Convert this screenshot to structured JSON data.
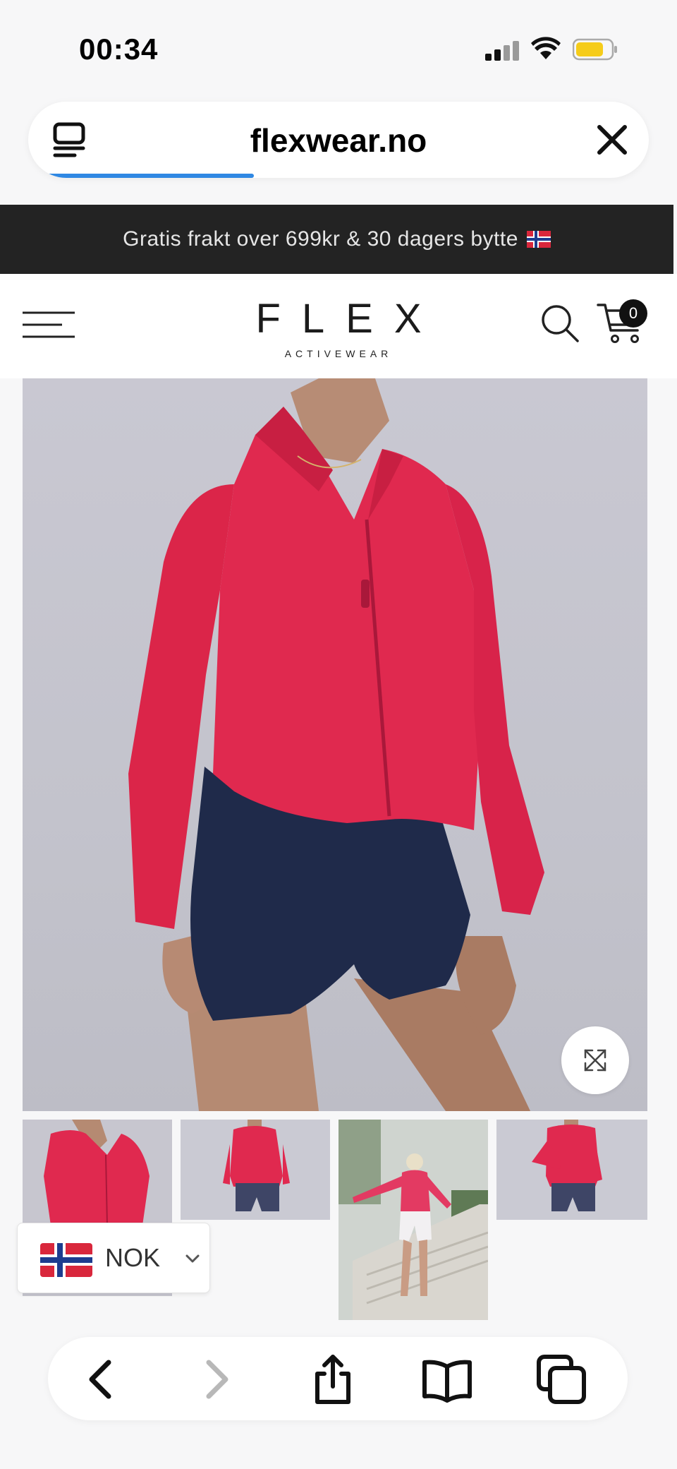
{
  "status_bar": {
    "time": "00:34"
  },
  "browser": {
    "url": "flexwear.no"
  },
  "promo": {
    "text": "Gratis frakt over 699kr & 30 dagers bytte"
  },
  "header": {
    "logo_main": "FLEX",
    "logo_sub": "ACTIVEWEAR",
    "cart_count": "0"
  },
  "currency": {
    "code": "NOK"
  },
  "colors": {
    "accent_progress": "#2f88e3",
    "promo_bg": "#232323",
    "jacket": "#e0294f",
    "shorts": "#1f2a4a"
  },
  "icons": {
    "tabs": "tabs-icon",
    "close": "close-icon",
    "menu": "menu-icon",
    "search": "search-icon",
    "cart": "cart-icon",
    "expand": "expand-icon",
    "back": "back-arrow-icon",
    "forward": "forward-arrow-icon",
    "share": "share-icon",
    "bookmarks": "bookmarks-icon",
    "tab_overview": "tab-overview-icon"
  }
}
